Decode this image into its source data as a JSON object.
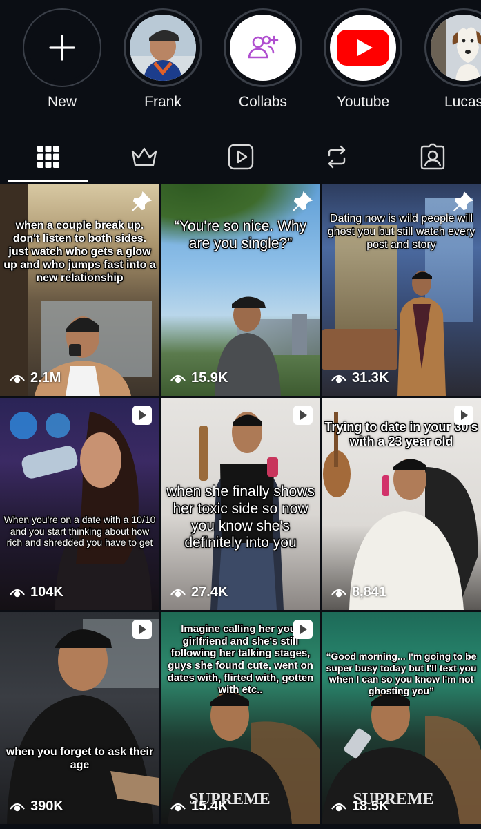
{
  "highlights": [
    {
      "label": "New",
      "icon": "plus-icon"
    },
    {
      "label": "Frank",
      "icon": "profile-photo"
    },
    {
      "label": "Collabs",
      "icon": "add-people-icon"
    },
    {
      "label": "Youtube",
      "icon": "youtube-icon"
    },
    {
      "label": "Lucas",
      "icon": "dog-photo"
    }
  ],
  "tabs": [
    {
      "name": "grid",
      "icon": "grid-icon",
      "active": true
    },
    {
      "name": "subscriptions",
      "icon": "crown-icon",
      "active": false
    },
    {
      "name": "reels",
      "icon": "reels-icon",
      "active": false
    },
    {
      "name": "reposts",
      "icon": "repost-icon",
      "active": false
    },
    {
      "name": "tagged",
      "icon": "tagged-icon",
      "active": false
    }
  ],
  "posts": [
    {
      "caption": "when a couple break up. don't listen to both sides. just watch who gets a glow up and who jumps fast into a new relationship",
      "views": "2.1M",
      "badge": "pin-icon"
    },
    {
      "caption": "“You're so nice. Why are you single?”",
      "views": "15.9K",
      "badge": "pin-icon"
    },
    {
      "caption": "Dating now is wild people will ghost you but still watch every post and story",
      "views": "31.3K",
      "badge": "pin-icon"
    },
    {
      "caption": "When you're on a date with a 10/10 and you start thinking about how rich and shredded you have to get",
      "views": "104K",
      "badge": "reel-icon"
    },
    {
      "caption": "when she finally shows her toxic side so now you know she's definitely into you",
      "views": "27.4K",
      "badge": "reel-icon"
    },
    {
      "caption": "Trying to date in your 30's with a 23 year old",
      "views": "8,841",
      "badge": "reel-icon"
    },
    {
      "caption": "when you forget to ask their age",
      "views": "390K",
      "badge": "reel-icon"
    },
    {
      "caption": "Imagine calling her your girlfriend and she's still following her talking stages, guys she found cute, went on dates with, flirted with, gotten with etc..",
      "views": "15.4K",
      "badge": "reel-icon"
    },
    {
      "caption": "“Good morning... I'm going to be super busy today but I'll text you when I can so you know I'm not ghosting you”",
      "views": "18.5K",
      "badge": "reel-icon"
    }
  ],
  "shirt_text": "SUPREME",
  "colors": {
    "background": "#0b0e14",
    "youtube_red": "#ff0000",
    "collab_purple": "#b04fd0",
    "ring": "#3a3f48"
  }
}
